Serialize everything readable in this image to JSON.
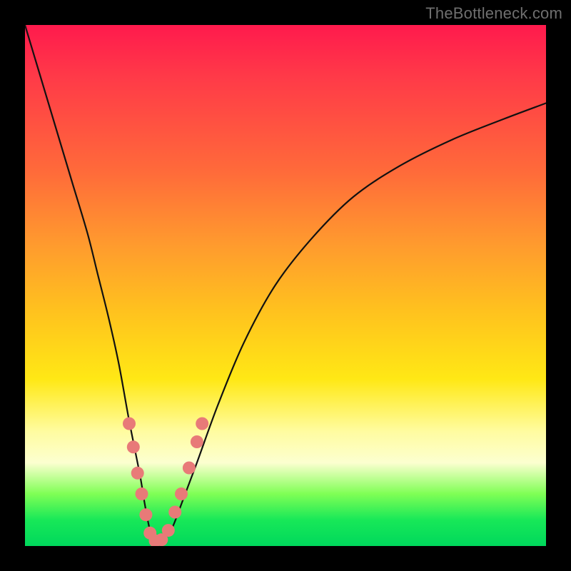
{
  "watermark": "TheBottleneck.com",
  "chart_data": {
    "type": "line",
    "title": "",
    "xlabel": "",
    "ylabel": "",
    "xlim": [
      0,
      100
    ],
    "ylim": [
      0,
      100
    ],
    "series": [
      {
        "name": "bottleneck-curve",
        "x": [
          0,
          3,
          6,
          9,
          12,
          14,
          16,
          18,
          20,
          22,
          23,
          24,
          25,
          26,
          28,
          30,
          33,
          37,
          42,
          48,
          55,
          63,
          72,
          82,
          92,
          100
        ],
        "y": [
          100,
          90,
          80,
          70,
          60,
          52,
          44,
          35,
          24,
          14,
          8,
          3,
          1,
          1,
          3,
          8,
          16,
          27,
          39,
          50,
          59,
          67,
          73,
          78,
          82,
          85
        ]
      }
    ],
    "markers": {
      "name": "highlighted-points",
      "color": "#e87a78",
      "points": [
        {
          "x": 20.0,
          "y": 23.5
        },
        {
          "x": 20.8,
          "y": 19.0
        },
        {
          "x": 21.6,
          "y": 14.0
        },
        {
          "x": 22.4,
          "y": 10.0
        },
        {
          "x": 23.2,
          "y": 6.0
        },
        {
          "x": 24.0,
          "y": 2.5
        },
        {
          "x": 25.0,
          "y": 1.0
        },
        {
          "x": 26.2,
          "y": 1.2
        },
        {
          "x": 27.5,
          "y": 3.0
        },
        {
          "x": 28.8,
          "y": 6.5
        },
        {
          "x": 30.0,
          "y": 10.0
        },
        {
          "x": 31.5,
          "y": 15.0
        },
        {
          "x": 33.0,
          "y": 20.0
        },
        {
          "x": 34.0,
          "y": 23.5
        }
      ]
    },
    "annotations": []
  }
}
